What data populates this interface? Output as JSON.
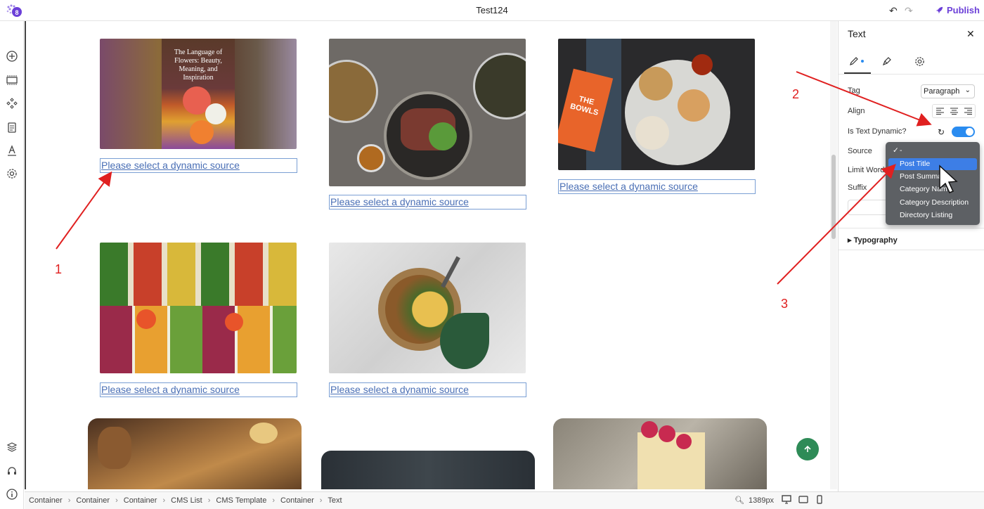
{
  "app": {
    "title": "Test124",
    "publish_label": "Publish"
  },
  "canvas": {
    "link_text": "Please select a dynamic source",
    "image_captions": {
      "flower_book": "The Language of Flowers: Beauty, Meaning, and Inspiration",
      "bowls_box": "THE BOWLS"
    }
  },
  "panel": {
    "title": "Text",
    "tag_label": "Tag",
    "tag_value": "Paragraph",
    "align_label": "Align",
    "dynamic_label": "Is Text Dynamic?",
    "source_label": "Source",
    "limit_label": "Limit Words",
    "suffix_label": "Suffix",
    "typography_label": "Typography"
  },
  "dropdown": {
    "items": [
      "-",
      "Post Title",
      "Post Summary",
      "Category Name",
      "Category Description",
      "Directory Listing"
    ],
    "checked": "-",
    "highlighted": "Post Title"
  },
  "statusbar": {
    "breadcrumbs": [
      "Container",
      "Container",
      "Container",
      "CMS List",
      "CMS Template",
      "Container",
      "Text"
    ],
    "zoom": "1389px"
  },
  "annotations": [
    "1",
    "2",
    "3"
  ],
  "colors": {
    "accent": "#6b3fd8",
    "toggle": "#2a8cf0",
    "link": "#4a6fb5",
    "annotation": "#e02020",
    "fab": "#2e8b57"
  }
}
